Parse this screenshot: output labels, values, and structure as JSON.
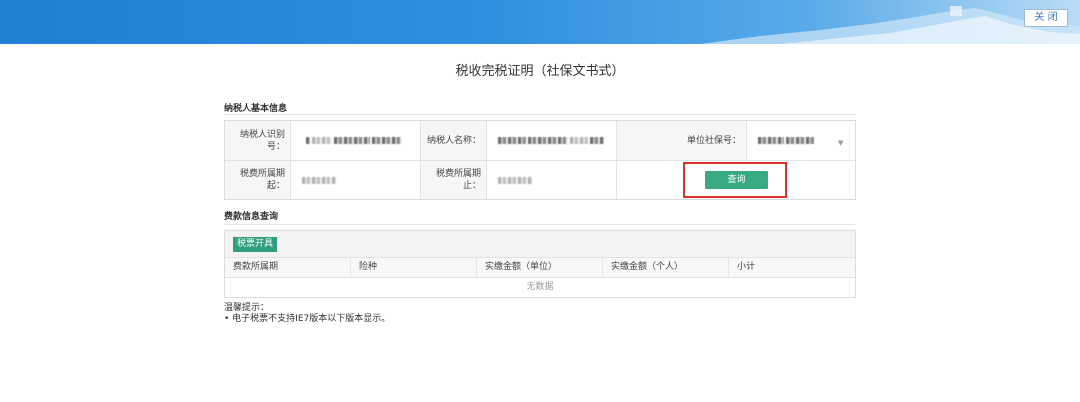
{
  "header": {
    "close_label": "关 闭"
  },
  "page": {
    "title": "税收完税证明（社保文书式）"
  },
  "basic_info": {
    "heading": "纳税人基本信息",
    "taxpayer_id_label": "纳税人识别号：",
    "taxpayer_name_label": "纳税人名称：",
    "social_security_label": "单位社保号：",
    "period_start_label": "税费所属期起：",
    "period_end_label": "税费所属期止：",
    "query_label": "查询"
  },
  "fee_info": {
    "heading": "费款信息查询",
    "invoice_button": "税票开具",
    "columns": [
      "费款所属期",
      "险种",
      "实缴金额（单位）",
      "实缴金额（个人）",
      "小计"
    ],
    "empty_text": "无数据"
  },
  "tips": {
    "title": "温馨提示：",
    "items": [
      "电子税票不支持IE7版本以下版本显示。"
    ]
  },
  "colors": {
    "banner": "#2f8fe0",
    "primary_button": "#37a983",
    "highlight": "#e0312a"
  }
}
